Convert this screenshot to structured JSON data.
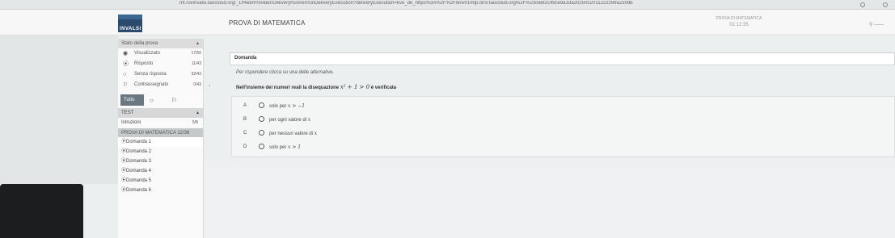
{
  "browser": {
    "url": "mt.rovinvalsi.taocloud.org/_1/f4eb/Provider/DeliveryRunner/runDeliveryExecution?deliveryExecution=kve_de_https%3A%2F%2Fitinv01mtp.itinv.taocloud.org%2F%23i5682c49ce9a1da2025052011222299a230db"
  },
  "header": {
    "logo_text": "INVALSI",
    "title": "PROVA DI MATEMATICA",
    "right_label": "PROVA DI MATEMATICA",
    "timer": "01:12:35"
  },
  "sidebar": {
    "status_title": "Stato della prova",
    "stats": [
      {
        "label": "Visualizzato",
        "count": "17/50",
        "icon": "eye-icon",
        "glyph": "◉"
      },
      {
        "label": "Risposto",
        "count": "11/43",
        "icon": "answered-icon",
        "glyph": "⦿"
      },
      {
        "label": "Senza risposta",
        "count": "32/43",
        "icon": "unanswered-icon",
        "glyph": "○"
      },
      {
        "label": "Contrassegnato",
        "count": "0/43",
        "icon": "flag-icon",
        "glyph": "⚐"
      }
    ],
    "filter_all": "Tutto",
    "section_test": "TEST",
    "instructions_label": "Istruzioni",
    "instructions_count": "5/5",
    "part_label": "PROVA DI MATEMATICA 12/36",
    "questions": [
      "Domanda 1",
      "Domanda 2",
      "Domanda 3",
      "Domanda 4",
      "Domanda 5",
      "Domanda 6"
    ]
  },
  "question": {
    "header": "Domanda",
    "hint": "Per rispondere clicca su una delle alternative.",
    "prompt_text": "Nell'insieme dei numeri reali la disequazione",
    "prompt_math": "x² + 1 > 0",
    "prompt_tail": "è verificata",
    "options": [
      {
        "letter": "A",
        "text": "solo per",
        "math": "x > −1"
      },
      {
        "letter": "B",
        "text": "per ogni valore di",
        "math": "x"
      },
      {
        "letter": "C",
        "text": "per nessun valore di",
        "math": "x"
      },
      {
        "letter": "D",
        "text": "solo per",
        "math": "x > 1"
      }
    ]
  },
  "colors": {
    "logo": "#2c4a6e",
    "filter_active": "#6b7882",
    "background": "#eceff0"
  }
}
